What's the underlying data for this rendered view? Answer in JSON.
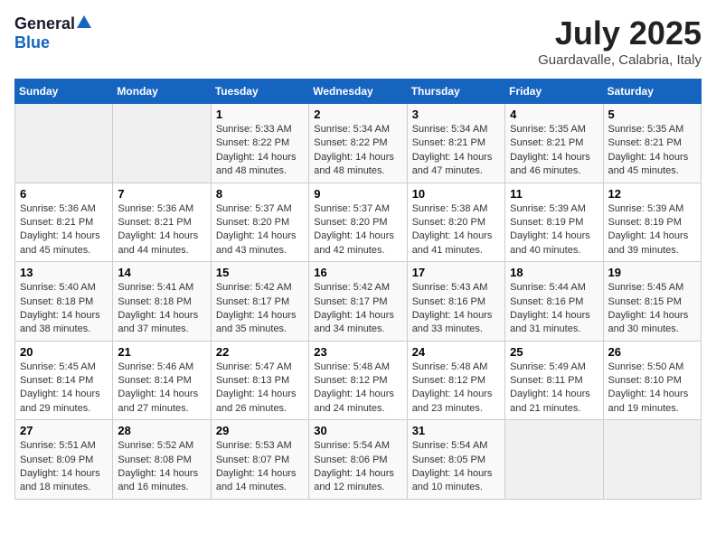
{
  "logo": {
    "general": "General",
    "blue": "Blue"
  },
  "title": "July 2025",
  "location": "Guardavalle, Calabria, Italy",
  "weekdays": [
    "Sunday",
    "Monday",
    "Tuesday",
    "Wednesday",
    "Thursday",
    "Friday",
    "Saturday"
  ],
  "weeks": [
    [
      {
        "day": "",
        "sunrise": "",
        "sunset": "",
        "daylight": ""
      },
      {
        "day": "",
        "sunrise": "",
        "sunset": "",
        "daylight": ""
      },
      {
        "day": "1",
        "sunrise": "Sunrise: 5:33 AM",
        "sunset": "Sunset: 8:22 PM",
        "daylight": "Daylight: 14 hours and 48 minutes."
      },
      {
        "day": "2",
        "sunrise": "Sunrise: 5:34 AM",
        "sunset": "Sunset: 8:22 PM",
        "daylight": "Daylight: 14 hours and 48 minutes."
      },
      {
        "day": "3",
        "sunrise": "Sunrise: 5:34 AM",
        "sunset": "Sunset: 8:21 PM",
        "daylight": "Daylight: 14 hours and 47 minutes."
      },
      {
        "day": "4",
        "sunrise": "Sunrise: 5:35 AM",
        "sunset": "Sunset: 8:21 PM",
        "daylight": "Daylight: 14 hours and 46 minutes."
      },
      {
        "day": "5",
        "sunrise": "Sunrise: 5:35 AM",
        "sunset": "Sunset: 8:21 PM",
        "daylight": "Daylight: 14 hours and 45 minutes."
      }
    ],
    [
      {
        "day": "6",
        "sunrise": "Sunrise: 5:36 AM",
        "sunset": "Sunset: 8:21 PM",
        "daylight": "Daylight: 14 hours and 45 minutes."
      },
      {
        "day": "7",
        "sunrise": "Sunrise: 5:36 AM",
        "sunset": "Sunset: 8:21 PM",
        "daylight": "Daylight: 14 hours and 44 minutes."
      },
      {
        "day": "8",
        "sunrise": "Sunrise: 5:37 AM",
        "sunset": "Sunset: 8:20 PM",
        "daylight": "Daylight: 14 hours and 43 minutes."
      },
      {
        "day": "9",
        "sunrise": "Sunrise: 5:37 AM",
        "sunset": "Sunset: 8:20 PM",
        "daylight": "Daylight: 14 hours and 42 minutes."
      },
      {
        "day": "10",
        "sunrise": "Sunrise: 5:38 AM",
        "sunset": "Sunset: 8:20 PM",
        "daylight": "Daylight: 14 hours and 41 minutes."
      },
      {
        "day": "11",
        "sunrise": "Sunrise: 5:39 AM",
        "sunset": "Sunset: 8:19 PM",
        "daylight": "Daylight: 14 hours and 40 minutes."
      },
      {
        "day": "12",
        "sunrise": "Sunrise: 5:39 AM",
        "sunset": "Sunset: 8:19 PM",
        "daylight": "Daylight: 14 hours and 39 minutes."
      }
    ],
    [
      {
        "day": "13",
        "sunrise": "Sunrise: 5:40 AM",
        "sunset": "Sunset: 8:18 PM",
        "daylight": "Daylight: 14 hours and 38 minutes."
      },
      {
        "day": "14",
        "sunrise": "Sunrise: 5:41 AM",
        "sunset": "Sunset: 8:18 PM",
        "daylight": "Daylight: 14 hours and 37 minutes."
      },
      {
        "day": "15",
        "sunrise": "Sunrise: 5:42 AM",
        "sunset": "Sunset: 8:17 PM",
        "daylight": "Daylight: 14 hours and 35 minutes."
      },
      {
        "day": "16",
        "sunrise": "Sunrise: 5:42 AM",
        "sunset": "Sunset: 8:17 PM",
        "daylight": "Daylight: 14 hours and 34 minutes."
      },
      {
        "day": "17",
        "sunrise": "Sunrise: 5:43 AM",
        "sunset": "Sunset: 8:16 PM",
        "daylight": "Daylight: 14 hours and 33 minutes."
      },
      {
        "day": "18",
        "sunrise": "Sunrise: 5:44 AM",
        "sunset": "Sunset: 8:16 PM",
        "daylight": "Daylight: 14 hours and 31 minutes."
      },
      {
        "day": "19",
        "sunrise": "Sunrise: 5:45 AM",
        "sunset": "Sunset: 8:15 PM",
        "daylight": "Daylight: 14 hours and 30 minutes."
      }
    ],
    [
      {
        "day": "20",
        "sunrise": "Sunrise: 5:45 AM",
        "sunset": "Sunset: 8:14 PM",
        "daylight": "Daylight: 14 hours and 29 minutes."
      },
      {
        "day": "21",
        "sunrise": "Sunrise: 5:46 AM",
        "sunset": "Sunset: 8:14 PM",
        "daylight": "Daylight: 14 hours and 27 minutes."
      },
      {
        "day": "22",
        "sunrise": "Sunrise: 5:47 AM",
        "sunset": "Sunset: 8:13 PM",
        "daylight": "Daylight: 14 hours and 26 minutes."
      },
      {
        "day": "23",
        "sunrise": "Sunrise: 5:48 AM",
        "sunset": "Sunset: 8:12 PM",
        "daylight": "Daylight: 14 hours and 24 minutes."
      },
      {
        "day": "24",
        "sunrise": "Sunrise: 5:48 AM",
        "sunset": "Sunset: 8:12 PM",
        "daylight": "Daylight: 14 hours and 23 minutes."
      },
      {
        "day": "25",
        "sunrise": "Sunrise: 5:49 AM",
        "sunset": "Sunset: 8:11 PM",
        "daylight": "Daylight: 14 hours and 21 minutes."
      },
      {
        "day": "26",
        "sunrise": "Sunrise: 5:50 AM",
        "sunset": "Sunset: 8:10 PM",
        "daylight": "Daylight: 14 hours and 19 minutes."
      }
    ],
    [
      {
        "day": "27",
        "sunrise": "Sunrise: 5:51 AM",
        "sunset": "Sunset: 8:09 PM",
        "daylight": "Daylight: 14 hours and 18 minutes."
      },
      {
        "day": "28",
        "sunrise": "Sunrise: 5:52 AM",
        "sunset": "Sunset: 8:08 PM",
        "daylight": "Daylight: 14 hours and 16 minutes."
      },
      {
        "day": "29",
        "sunrise": "Sunrise: 5:53 AM",
        "sunset": "Sunset: 8:07 PM",
        "daylight": "Daylight: 14 hours and 14 minutes."
      },
      {
        "day": "30",
        "sunrise": "Sunrise: 5:54 AM",
        "sunset": "Sunset: 8:06 PM",
        "daylight": "Daylight: 14 hours and 12 minutes."
      },
      {
        "day": "31",
        "sunrise": "Sunrise: 5:54 AM",
        "sunset": "Sunset: 8:05 PM",
        "daylight": "Daylight: 14 hours and 10 minutes."
      },
      {
        "day": "",
        "sunrise": "",
        "sunset": "",
        "daylight": ""
      },
      {
        "day": "",
        "sunrise": "",
        "sunset": "",
        "daylight": ""
      }
    ]
  ]
}
